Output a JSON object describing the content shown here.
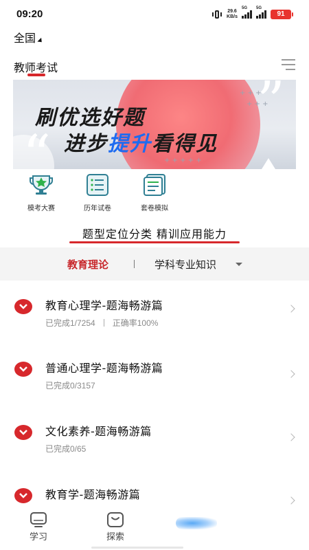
{
  "status_bar": {
    "time": "09:20",
    "net_speed_value": "29.6",
    "net_speed_unit": "KB/s",
    "signal_1_label": "5G",
    "signal_2_label": "5G",
    "battery": "91"
  },
  "header": {
    "region": "全国",
    "tab_label": "教师考试"
  },
  "banner": {
    "line1": "刷优选好题",
    "line2_prefix": "进步",
    "line2_highlight": "提升",
    "line2_suffix": "看得见"
  },
  "quick_actions": [
    {
      "label": "模考大赛",
      "icon": "trophy-icon"
    },
    {
      "label": "历年试卷",
      "icon": "paper-list-icon"
    },
    {
      "label": "套卷模拟",
      "icon": "test-set-icon"
    }
  ],
  "slogan": "题型定位分类 精训应用能力",
  "subject_filter": {
    "active": "教育理论",
    "other": "学科专业知识"
  },
  "list": [
    {
      "title": "教育心理学-题海畅游篇",
      "progress": "已完成1/7254",
      "accuracy": "正确率100%"
    },
    {
      "title": "普通心理学-题海畅游篇",
      "progress": "已完成0/3157",
      "accuracy": ""
    },
    {
      "title": "文化素养-题海畅游篇",
      "progress": "已完成0/65",
      "accuracy": ""
    },
    {
      "title": "教育学-题海畅游篇",
      "progress": "",
      "accuracy": ""
    }
  ],
  "bottom_nav": [
    {
      "label": "学习",
      "icon": "study-icon"
    },
    {
      "label": "探索",
      "icon": "explore-icon"
    }
  ],
  "colors": {
    "accent_red": "#d7282c",
    "highlight_blue": "#1e6bf0"
  }
}
